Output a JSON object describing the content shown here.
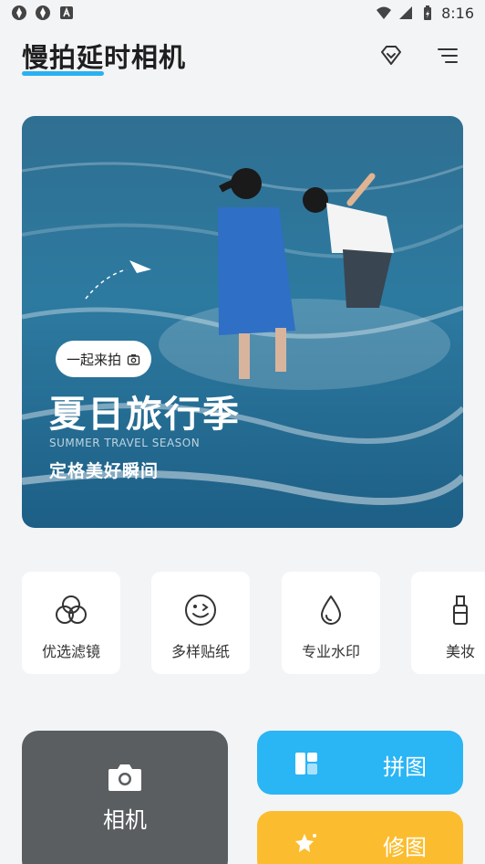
{
  "status_bar": {
    "time": "8:16"
  },
  "header": {
    "title": "慢拍延时相机",
    "accent_color": "#2ab1f0"
  },
  "banner": {
    "tag_label": "一起来拍",
    "title": "夏日旅行季",
    "subtitle_en": "SUMMER TRAVEL SEASON",
    "subtitle": "定格美好瞬间"
  },
  "features": [
    {
      "label": "优选滤镜",
      "icon": "filter-icon"
    },
    {
      "label": "多样贴纸",
      "icon": "sticker-icon"
    },
    {
      "label": "专业水印",
      "icon": "watermark-icon"
    },
    {
      "label": "美妆",
      "icon": "makeup-icon"
    }
  ],
  "actions": {
    "camera_label": "相机",
    "collage_label": "拼图",
    "edit_label": "修图",
    "camera_color": "#5a5e61",
    "collage_color": "#2ab5f5",
    "edit_color": "#fbbd2f"
  }
}
